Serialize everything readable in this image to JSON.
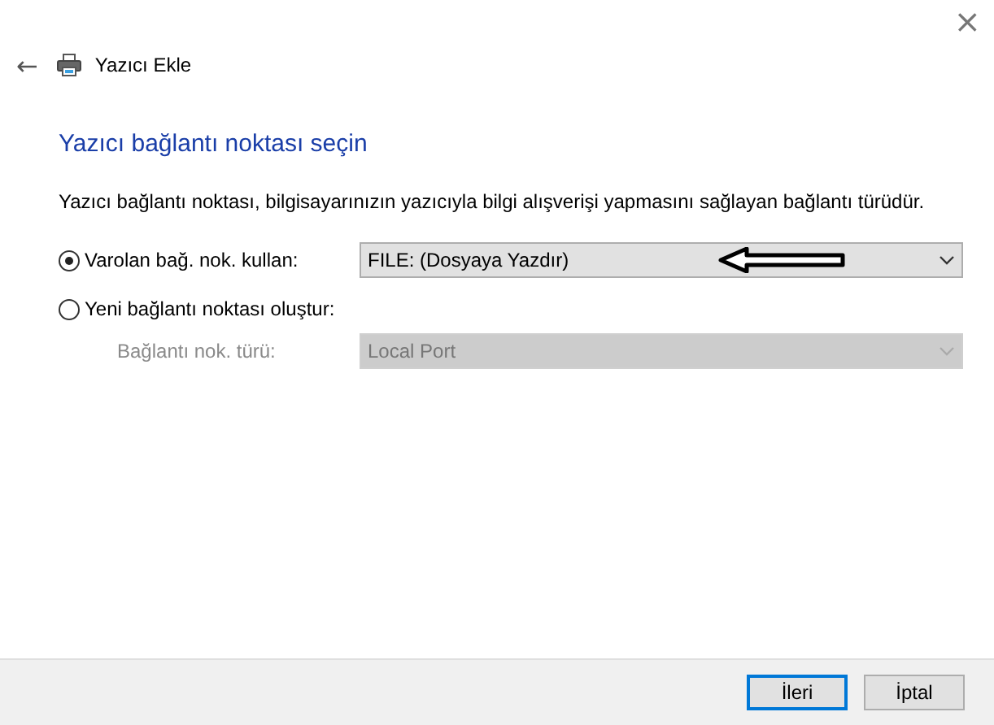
{
  "window": {
    "close": "×"
  },
  "header": {
    "back": "←",
    "title": "Yazıcı Ekle"
  },
  "heading": "Yazıcı bağlantı noktası seçin",
  "description": "Yazıcı bağlantı noktası, bilgisayarınızın yazıcıyla bilgi alışverişi yapmasını sağlayan bağlantı türüdür.",
  "options": [
    {
      "label": "Varolan bağ. nok. kullan:",
      "selected": true,
      "marked": true,
      "dropdown": {
        "value": "FILE: (Dosyaya Yazdır)",
        "disabled": false
      }
    },
    {
      "label": "Yeni bağlantı noktası oluştur:",
      "selected": false,
      "sublabel": "Bağlantı nok. türü:",
      "dropdown": {
        "value": "Local Port",
        "disabled": true
      }
    }
  ],
  "buttons": [
    {
      "label": "İleri",
      "default": true
    },
    {
      "label": "İptal",
      "default": false
    }
  ]
}
